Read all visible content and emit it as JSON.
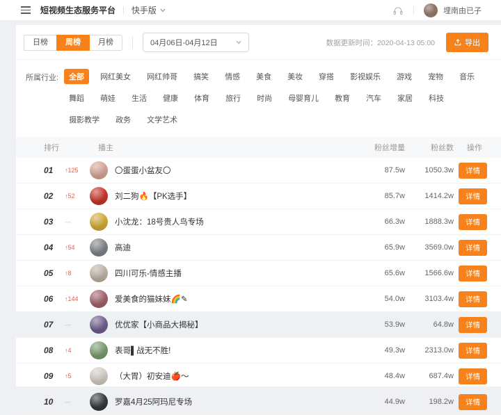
{
  "topbar": {
    "title": "短视频生态服务平台",
    "separator": "|",
    "version_label": "快手版",
    "username": "埋南由已子"
  },
  "controls": {
    "tabs": [
      {
        "label": "日榜",
        "active": false
      },
      {
        "label": "周榜",
        "active": true
      },
      {
        "label": "月榜",
        "active": false
      }
    ],
    "date_range": "04月06日-04月12日",
    "update_time_label": "数据更新时间：",
    "update_time": "2020-04-13 05:00",
    "export_label": "导出"
  },
  "filters": {
    "label": "所属行业:",
    "tags": [
      {
        "label": "全部",
        "active": true
      },
      {
        "label": "网红美女",
        "active": false
      },
      {
        "label": "网红帅哥",
        "active": false
      },
      {
        "label": "搞笑",
        "active": false
      },
      {
        "label": "情感",
        "active": false
      },
      {
        "label": "美食",
        "active": false
      },
      {
        "label": "美妆",
        "active": false
      },
      {
        "label": "穿搭",
        "active": false
      },
      {
        "label": "影视娱乐",
        "active": false
      },
      {
        "label": "游戏",
        "active": false
      },
      {
        "label": "宠物",
        "active": false
      },
      {
        "label": "音乐",
        "active": false
      },
      {
        "label": "舞蹈",
        "active": false
      },
      {
        "label": "萌娃",
        "active": false
      },
      {
        "label": "生活",
        "active": false
      },
      {
        "label": "健康",
        "active": false
      },
      {
        "label": "体育",
        "active": false
      },
      {
        "label": "旅行",
        "active": false
      },
      {
        "label": "时尚",
        "active": false
      },
      {
        "label": "母婴育儿",
        "active": false
      },
      {
        "label": "教育",
        "active": false
      },
      {
        "label": "汽车",
        "active": false
      },
      {
        "label": "家居",
        "active": false
      },
      {
        "label": "科技",
        "active": false
      },
      {
        "label": "摄影教学",
        "active": false
      },
      {
        "label": "政务",
        "active": false
      },
      {
        "label": "文学艺术",
        "active": false
      }
    ]
  },
  "table": {
    "columns": [
      "排行",
      "播主",
      "粉丝增量",
      "粉丝数",
      "操作"
    ],
    "up_arrow": "↑",
    "detail_label": "详情",
    "rows": [
      {
        "rank": "01",
        "change": "125",
        "is_up": true,
        "name": "〇蛋蛋小盆友〇",
        "fans_gain": "87.5w",
        "fans_total": "1050.3w",
        "avatar_color": "#e8b4a4",
        "highlighted": false
      },
      {
        "rank": "02",
        "change": "52",
        "is_up": true,
        "name": "刘二狗🔥【PK选手】",
        "fans_gain": "85.7w",
        "fans_total": "1414.2w",
        "avatar_color": "#d93a2f",
        "highlighted": false
      },
      {
        "rank": "03",
        "change": "—",
        "is_up": false,
        "name": "小沈龙：18号贵人鸟专场",
        "fans_gain": "66.3w",
        "fans_total": "1888.3w",
        "avatar_color": "#e5b93c",
        "highlighted": false
      },
      {
        "rank": "04",
        "change": "54",
        "is_up": true,
        "name": "高迪",
        "fans_gain": "65.9w",
        "fans_total": "3569.0w",
        "avatar_color": "#8a8f96",
        "highlighted": false
      },
      {
        "rank": "05",
        "change": "8",
        "is_up": true,
        "name": "四川可乐-情感主播",
        "fans_gain": "65.6w",
        "fans_total": "1566.6w",
        "avatar_color": "#cfc2b4",
        "highlighted": false
      },
      {
        "rank": "06",
        "change": "144",
        "is_up": true,
        "name": "爱美食的猫妹妹🌈✎",
        "fans_gain": "54.0w",
        "fans_total": "3103.4w",
        "avatar_color": "#b06a74",
        "highlighted": false
      },
      {
        "rank": "07",
        "change": "—",
        "is_up": false,
        "name": "优优家【小商品大揭秘】",
        "fans_gain": "53.9w",
        "fans_total": "64.8w",
        "avatar_color": "#7a6699",
        "highlighted": true
      },
      {
        "rank": "08",
        "change": "4",
        "is_up": true,
        "name": "表哥▌战无不胜!",
        "fans_gain": "49.3w",
        "fans_total": "2313.0w",
        "avatar_color": "#86a878",
        "highlighted": false
      },
      {
        "rank": "09",
        "change": "5",
        "is_up": true,
        "name": "（大胃）初安迪🍎～",
        "fans_gain": "48.4w",
        "fans_total": "687.4w",
        "avatar_color": "#e3ddd4",
        "highlighted": false
      },
      {
        "rank": "10",
        "change": "—",
        "is_up": false,
        "name": "罗嘉4月25阿玛尼专场",
        "fans_gain": "44.9w",
        "fans_total": "198.2w",
        "avatar_color": "#3a3d42",
        "highlighted": false
      }
    ]
  },
  "colors": {
    "accent_orange": "#f7821b",
    "change_up_red": "#f5594e",
    "page_background": "#eef0f3"
  }
}
